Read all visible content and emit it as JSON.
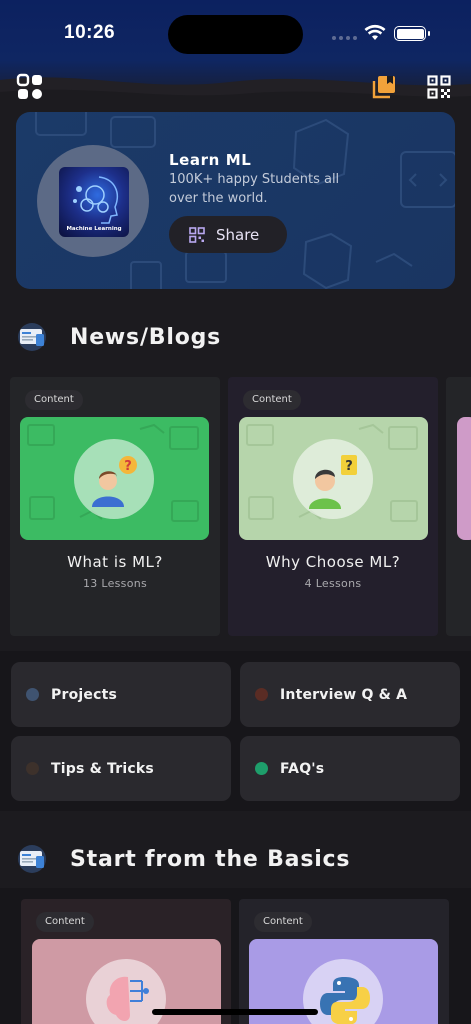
{
  "status_bar": {
    "time": "10:26"
  },
  "hero": {
    "logo_caption": "Machine Learning",
    "title": "Learn ML",
    "subtitle": "100K+ happy Students all over the world.",
    "share_label": "Share"
  },
  "news_section": {
    "title": "News/Blogs",
    "cards": [
      {
        "chip": "Content",
        "title": "What is ML?",
        "subtitle": "13 Lessons",
        "thumb_color": "#3cbb63"
      },
      {
        "chip": "Content",
        "title": "Why Choose ML?",
        "subtitle": "4 Lessons",
        "thumb_color": "#b6d5ab"
      }
    ]
  },
  "quick_links": [
    {
      "label": "Projects",
      "dot_color": "#3f5370"
    },
    {
      "label": "Interview Q & A",
      "dot_color": "#5a2c24"
    },
    {
      "label": "Tips & Tricks",
      "dot_color": "#3d312b"
    },
    {
      "label": "FAQ's",
      "dot_color": "#1e9e6b"
    }
  ],
  "basics_section": {
    "title": "Start from the Basics",
    "cards": [
      {
        "chip": "Content",
        "thumb_color": "#cf9aa4"
      },
      {
        "chip": "Content",
        "thumb_color": "#a99be6"
      }
    ]
  }
}
